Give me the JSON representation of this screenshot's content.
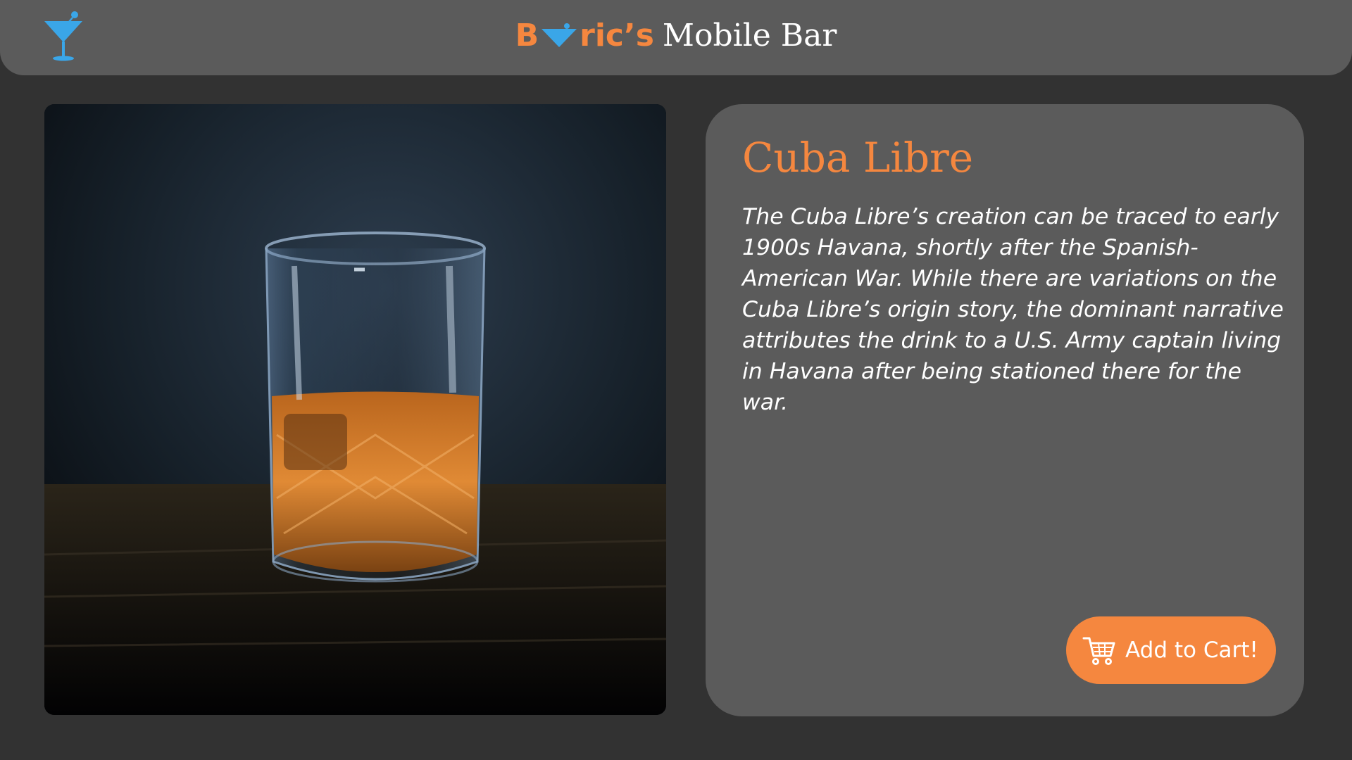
{
  "header": {
    "brand_prefix": "B",
    "brand_suffix": "ric’s",
    "brand_rest": "Mobile Bar",
    "logo_icon": "martini-glass-icon",
    "accent_color": "#f5873f",
    "icon_color": "#3aa6e8"
  },
  "product": {
    "image_icon": "cocktail-glass-photo",
    "title": "Cuba Libre",
    "description": "The Cuba Libre’s creation can be traced to early 1900s Havana, shortly after the Spanish-American War. While there are variations on the Cuba Libre’s origin story, the dominant narrative attributes the drink to a U.S. Army captain living in Havana after being stationed there for the war.",
    "cart_button_label": "Add to Cart!",
    "cart_icon": "shopping-cart-icon"
  }
}
